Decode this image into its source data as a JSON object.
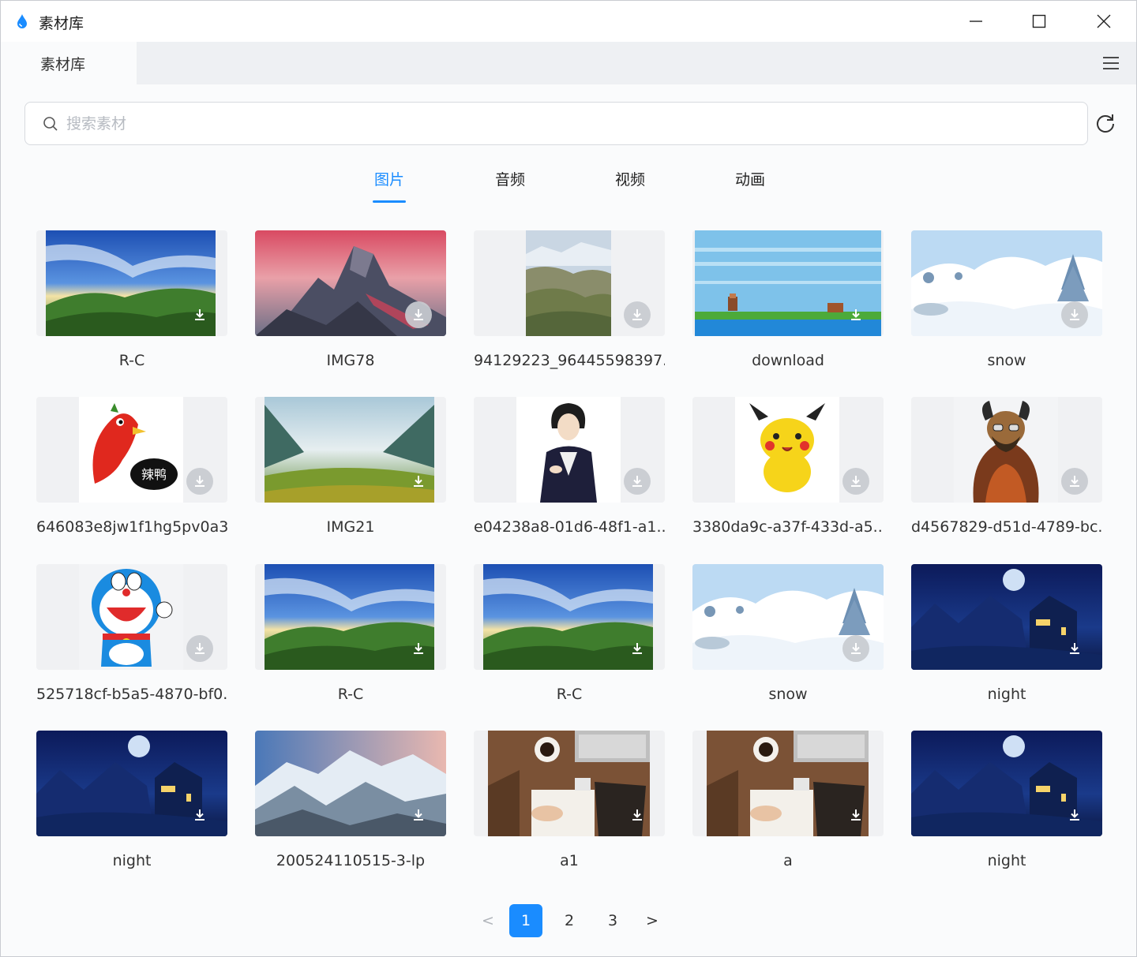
{
  "window": {
    "title": "素材库",
    "accent": "#1a8cff"
  },
  "tabstrip": {
    "tab_label": "素材库"
  },
  "search": {
    "placeholder": "搜索素材",
    "value": ""
  },
  "categories": [
    {
      "label": "图片",
      "active": true
    },
    {
      "label": "音频",
      "active": false
    },
    {
      "label": "视频",
      "active": false
    },
    {
      "label": "动画",
      "active": false
    }
  ],
  "items": [
    {
      "name": "R-C",
      "art": "valley"
    },
    {
      "name": "IMG78",
      "art": "peaks"
    },
    {
      "name": "94129223_96445598397...",
      "art": "hills"
    },
    {
      "name": "download",
      "art": "pixel"
    },
    {
      "name": "snow",
      "art": "snow"
    },
    {
      "name": "646083e8jw1f1hg5pv0a3...",
      "art": "bird"
    },
    {
      "name": "IMG21",
      "art": "mist"
    },
    {
      "name": "e04238a8-01d6-48f1-a1...",
      "art": "figure"
    },
    {
      "name": "3380da9c-a37f-433d-a5...",
      "art": "pikachu"
    },
    {
      "name": "d4567829-d51d-4789-bc...",
      "art": "warrior"
    },
    {
      "name": "525718cf-b5a5-4870-bf0...",
      "art": "doraemon"
    },
    {
      "name": "R-C",
      "art": "valley"
    },
    {
      "name": "R-C",
      "art": "valley"
    },
    {
      "name": "snow",
      "art": "snow"
    },
    {
      "name": "night",
      "art": "night"
    },
    {
      "name": "night",
      "art": "night"
    },
    {
      "name": "200524110515-3-lp",
      "art": "alps"
    },
    {
      "name": "a1",
      "art": "desk"
    },
    {
      "name": "a",
      "art": "desk"
    },
    {
      "name": "night",
      "art": "night"
    }
  ],
  "pagination": {
    "prev": "<",
    "pages": [
      "1",
      "2",
      "3"
    ],
    "current": "1",
    "next": ">"
  }
}
